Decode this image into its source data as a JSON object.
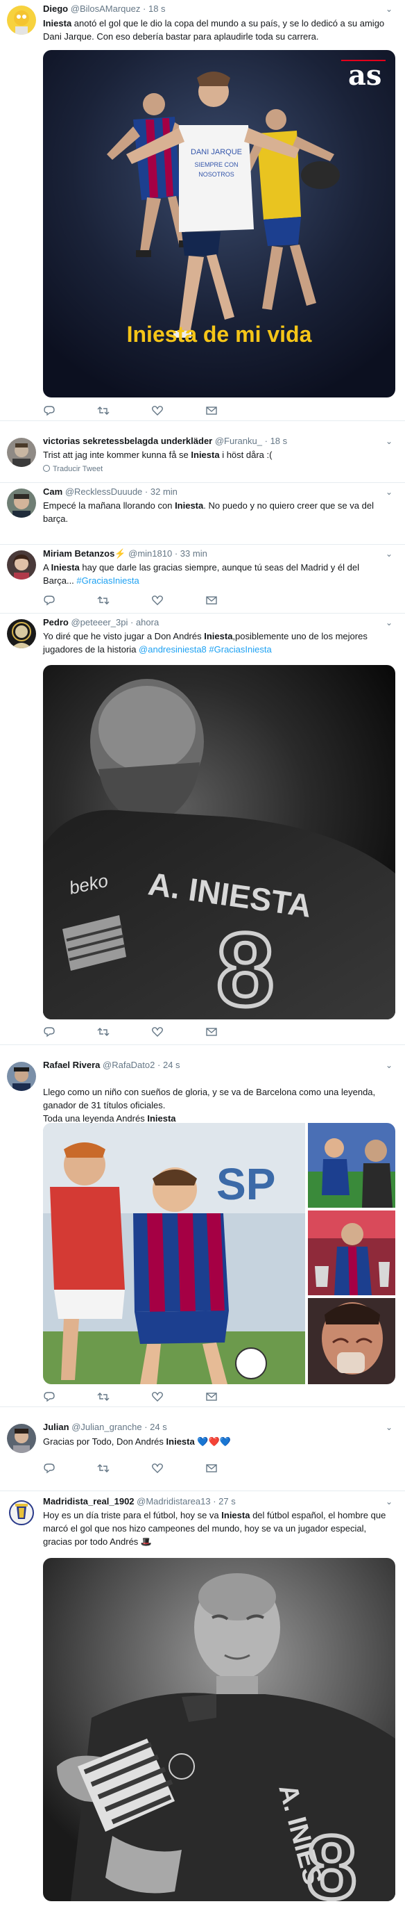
{
  "tweets": [
    {
      "name": "Diego",
      "handle": "@BilosAMarquez",
      "time": "18 s",
      "text_runs": [
        {
          "t": "Iniesta",
          "b": true
        },
        {
          "t": " anotó el gol que le dio la copa del mundo a su país, y se lo dedicó a su amigo Dani Jarque. Con eso debería bastar para aplaudirle toda su carrera.",
          "b": false
        }
      ],
      "image": {
        "logo": "as",
        "jersey_text": "DANI JARQUE SIEMPRE CON NOSOTROS",
        "caption": "Iniesta de mi vida"
      }
    },
    {
      "name": "victorias sekretessbelagda underkläder",
      "handle": "@Furanku_",
      "time": "18 s",
      "text_runs": [
        {
          "t": "Trist att jag inte kommer kunna få se ",
          "b": false
        },
        {
          "t": "Iniesta",
          "b": true
        },
        {
          "t": " i höst dåra :(",
          "b": false
        }
      ],
      "translate": "Traducir Tweet"
    },
    {
      "name": "Cam",
      "handle": "@RecklessDuuude",
      "time": "32 min",
      "text_runs": [
        {
          "t": "Empecé la mañana llorando con ",
          "b": false
        },
        {
          "t": "Iniesta",
          "b": true
        },
        {
          "t": ". No puedo y no quiero creer que se va del barça.",
          "b": false
        }
      ]
    },
    {
      "name": "Miriam Betanzos⚡",
      "handle": "@min1810",
      "time": "33 min",
      "text_runs": [
        {
          "t": "A ",
          "b": false
        },
        {
          "t": "Iniesta",
          "b": true
        },
        {
          "t": " hay que darle las gracias siempre, aunque tú seas del Madrid y él del Barça... ",
          "b": false
        },
        {
          "t": "#GraciasIniesta",
          "link": true
        }
      ]
    },
    {
      "name": "Pedro",
      "handle": "@peteeer_3pi",
      "time": "ahora",
      "text_runs": [
        {
          "t": "Yo diré que he visto jugar a Don Andrés ",
          "b": false
        },
        {
          "t": "Iniesta",
          "b": true
        },
        {
          "t": ",posiblemente uno de los mejores jugadores de la historia ",
          "b": false
        },
        {
          "t": "@andresiniesta8 #GraciasIniesta",
          "link": true
        }
      ],
      "image": {
        "kit_brand": "beko",
        "shirt_name": "A. INIESTA",
        "shirt_number": "8"
      }
    },
    {
      "name": "Rafael Rivera",
      "handle": "@RafaDato2",
      "time": "24 s",
      "text_runs": [
        {
          "t": "Llego como un niño con sueños de gloria, y se va de Barcelona como una leyenda, ganador de 31 títulos oficiales.\nToda una leyenda Andrés ",
          "b": false
        },
        {
          "t": "Iniesta",
          "b": true
        }
      ],
      "image": {
        "banner_text": "SP"
      }
    },
    {
      "name": "Julian",
      "handle": "@Julian_granche",
      "time": "24 s",
      "text_runs": [
        {
          "t": "Gracias por Todo, Don Andrés ",
          "b": false
        },
        {
          "t": "Iniesta",
          "b": true
        },
        {
          "t": " 💙❤️💙",
          "b": false
        }
      ]
    },
    {
      "name": "Madridista_real_1902",
      "handle": "@Madridistarea13",
      "time": "27 s",
      "text_runs": [
        {
          "t": "Hoy es un día triste para el fútbol, hoy se va ",
          "b": false
        },
        {
          "t": "Iniesta",
          "b": true
        },
        {
          "t": " del fútbol español, el hombre que marcó el gol que nos hizo campeones del mundo, hoy se va un jugador especial, gracias por todo Andrés 🎩",
          "b": false
        }
      ],
      "image": {
        "shirt_name": "A. INIES",
        "shirt_number": "8"
      }
    }
  ],
  "icons": [
    "reply-icon",
    "retweet-icon",
    "like-icon",
    "message-icon",
    "chevron-down-icon",
    "globe-icon"
  ],
  "colors": {
    "link": "#1da1f2",
    "secondary": "#657786",
    "separator": "#e6ecf0",
    "caption": "#f5c518"
  }
}
